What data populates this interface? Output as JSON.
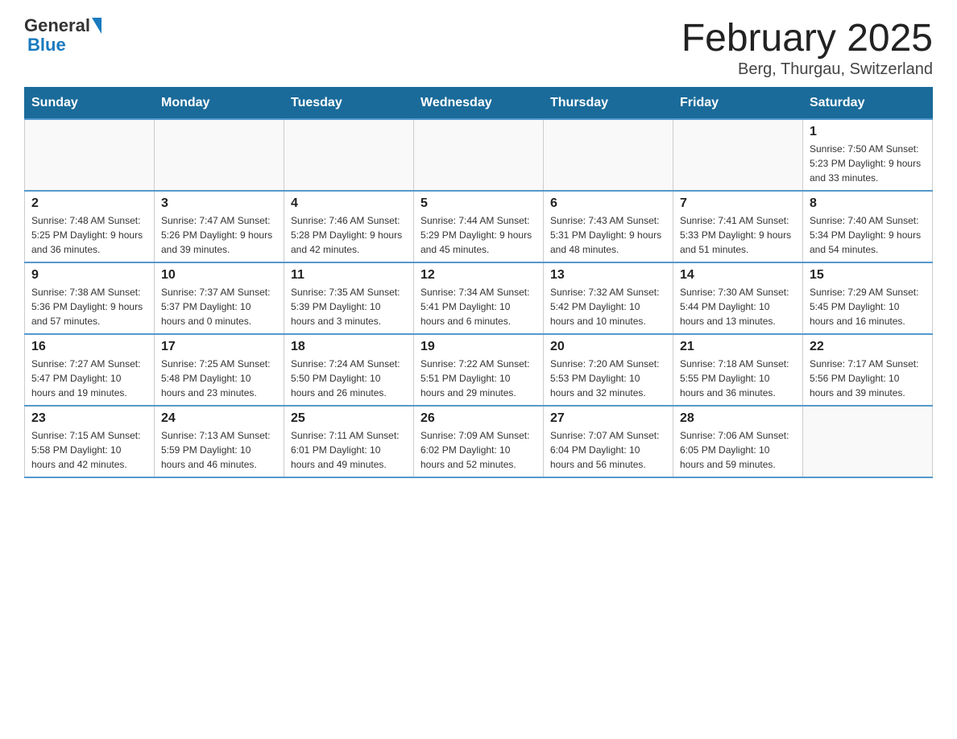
{
  "header": {
    "logo_general": "General",
    "logo_blue": "Blue",
    "month_title": "February 2025",
    "location": "Berg, Thurgau, Switzerland"
  },
  "days_of_week": [
    "Sunday",
    "Monday",
    "Tuesday",
    "Wednesday",
    "Thursday",
    "Friday",
    "Saturday"
  ],
  "weeks": [
    [
      {
        "day": "",
        "info": ""
      },
      {
        "day": "",
        "info": ""
      },
      {
        "day": "",
        "info": ""
      },
      {
        "day": "",
        "info": ""
      },
      {
        "day": "",
        "info": ""
      },
      {
        "day": "",
        "info": ""
      },
      {
        "day": "1",
        "info": "Sunrise: 7:50 AM\nSunset: 5:23 PM\nDaylight: 9 hours\nand 33 minutes."
      }
    ],
    [
      {
        "day": "2",
        "info": "Sunrise: 7:48 AM\nSunset: 5:25 PM\nDaylight: 9 hours\nand 36 minutes."
      },
      {
        "day": "3",
        "info": "Sunrise: 7:47 AM\nSunset: 5:26 PM\nDaylight: 9 hours\nand 39 minutes."
      },
      {
        "day": "4",
        "info": "Sunrise: 7:46 AM\nSunset: 5:28 PM\nDaylight: 9 hours\nand 42 minutes."
      },
      {
        "day": "5",
        "info": "Sunrise: 7:44 AM\nSunset: 5:29 PM\nDaylight: 9 hours\nand 45 minutes."
      },
      {
        "day": "6",
        "info": "Sunrise: 7:43 AM\nSunset: 5:31 PM\nDaylight: 9 hours\nand 48 minutes."
      },
      {
        "day": "7",
        "info": "Sunrise: 7:41 AM\nSunset: 5:33 PM\nDaylight: 9 hours\nand 51 minutes."
      },
      {
        "day": "8",
        "info": "Sunrise: 7:40 AM\nSunset: 5:34 PM\nDaylight: 9 hours\nand 54 minutes."
      }
    ],
    [
      {
        "day": "9",
        "info": "Sunrise: 7:38 AM\nSunset: 5:36 PM\nDaylight: 9 hours\nand 57 minutes."
      },
      {
        "day": "10",
        "info": "Sunrise: 7:37 AM\nSunset: 5:37 PM\nDaylight: 10 hours\nand 0 minutes."
      },
      {
        "day": "11",
        "info": "Sunrise: 7:35 AM\nSunset: 5:39 PM\nDaylight: 10 hours\nand 3 minutes."
      },
      {
        "day": "12",
        "info": "Sunrise: 7:34 AM\nSunset: 5:41 PM\nDaylight: 10 hours\nand 6 minutes."
      },
      {
        "day": "13",
        "info": "Sunrise: 7:32 AM\nSunset: 5:42 PM\nDaylight: 10 hours\nand 10 minutes."
      },
      {
        "day": "14",
        "info": "Sunrise: 7:30 AM\nSunset: 5:44 PM\nDaylight: 10 hours\nand 13 minutes."
      },
      {
        "day": "15",
        "info": "Sunrise: 7:29 AM\nSunset: 5:45 PM\nDaylight: 10 hours\nand 16 minutes."
      }
    ],
    [
      {
        "day": "16",
        "info": "Sunrise: 7:27 AM\nSunset: 5:47 PM\nDaylight: 10 hours\nand 19 minutes."
      },
      {
        "day": "17",
        "info": "Sunrise: 7:25 AM\nSunset: 5:48 PM\nDaylight: 10 hours\nand 23 minutes."
      },
      {
        "day": "18",
        "info": "Sunrise: 7:24 AM\nSunset: 5:50 PM\nDaylight: 10 hours\nand 26 minutes."
      },
      {
        "day": "19",
        "info": "Sunrise: 7:22 AM\nSunset: 5:51 PM\nDaylight: 10 hours\nand 29 minutes."
      },
      {
        "day": "20",
        "info": "Sunrise: 7:20 AM\nSunset: 5:53 PM\nDaylight: 10 hours\nand 32 minutes."
      },
      {
        "day": "21",
        "info": "Sunrise: 7:18 AM\nSunset: 5:55 PM\nDaylight: 10 hours\nand 36 minutes."
      },
      {
        "day": "22",
        "info": "Sunrise: 7:17 AM\nSunset: 5:56 PM\nDaylight: 10 hours\nand 39 minutes."
      }
    ],
    [
      {
        "day": "23",
        "info": "Sunrise: 7:15 AM\nSunset: 5:58 PM\nDaylight: 10 hours\nand 42 minutes."
      },
      {
        "day": "24",
        "info": "Sunrise: 7:13 AM\nSunset: 5:59 PM\nDaylight: 10 hours\nand 46 minutes."
      },
      {
        "day": "25",
        "info": "Sunrise: 7:11 AM\nSunset: 6:01 PM\nDaylight: 10 hours\nand 49 minutes."
      },
      {
        "day": "26",
        "info": "Sunrise: 7:09 AM\nSunset: 6:02 PM\nDaylight: 10 hours\nand 52 minutes."
      },
      {
        "day": "27",
        "info": "Sunrise: 7:07 AM\nSunset: 6:04 PM\nDaylight: 10 hours\nand 56 minutes."
      },
      {
        "day": "28",
        "info": "Sunrise: 7:06 AM\nSunset: 6:05 PM\nDaylight: 10 hours\nand 59 minutes."
      },
      {
        "day": "",
        "info": ""
      }
    ]
  ],
  "colors": {
    "header_bg": "#1a6b9a",
    "header_text": "#ffffff",
    "border_accent": "#5599cc"
  }
}
